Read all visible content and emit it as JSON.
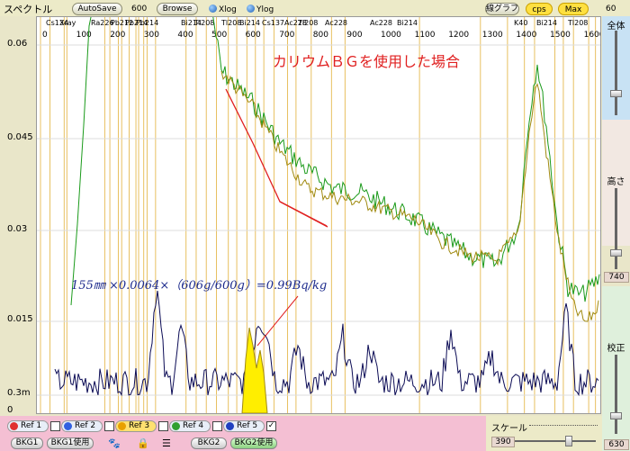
{
  "header": {
    "title": "スペクトル",
    "autosave_label": "AutoSave",
    "time_value": "600",
    "browse_label": "Browse",
    "xlog_label": "Xlog",
    "ylog_label": "Ylog",
    "linegraph_label": "線グラフ",
    "cps_label": "cps",
    "max_label": "Max",
    "right_value": "60"
  },
  "plot": {
    "y_ticks": [
      "0.06",
      "0.045",
      "0.03",
      "0.015",
      "0.3m",
      "0"
    ],
    "x_ticks": [
      "0",
      "100",
      "200",
      "300",
      "400",
      "500",
      "600",
      "700",
      "800",
      "900",
      "1000",
      "1100",
      "1200",
      "1300",
      "1400",
      "1500",
      "1600"
    ],
    "peak_labels": [
      "Cs134",
      "Xray",
      "Ra226",
      "Pb212",
      "Pb214",
      "Pb214",
      "Bi214",
      "Tl208",
      "Tl208",
      "Bi214",
      "Cs137",
      "Ac228",
      "Tl208",
      "Ac228",
      "Ac228",
      "Bi214",
      "K40",
      "Bi214",
      "Tl208"
    ],
    "annotation_title": "カリウムＢＧを使用した場合",
    "annotation_formula": "155㎜ ×0.0064×（606g/600g）=0.99Bq/kg",
    "colors": {
      "green": "#1a9a1a",
      "olive": "#a08a10",
      "navy": "#0b0b55",
      "yellow_fill": "#ffee00",
      "red": "#e02020",
      "gridline": "#e8c060"
    }
  },
  "sidebar": {
    "zoom_label": "全体",
    "height_label": "高さ",
    "height_value": "740",
    "calib_label": "校正",
    "calib_value": "630"
  },
  "bottom": {
    "refs": [
      {
        "label": "Ref 1",
        "color": "#e03030",
        "checked": false
      },
      {
        "label": "Ref 2",
        "color": "#3060e0",
        "checked": false
      },
      {
        "label": "Ref 3",
        "color": "#e8a000",
        "checked": false
      },
      {
        "label": "Ref 4",
        "color": "#30a030",
        "checked": false
      },
      {
        "label": "Ref 5",
        "color": "#2040c0",
        "checked": true
      }
    ],
    "bkg1_label": "BKG1",
    "bkg1_use_label": "BKG1使用",
    "bkg2_label": "BKG2",
    "bkg2_use_label": "BKG2使用",
    "scale_label": "スケール",
    "scale_value": "390"
  }
}
